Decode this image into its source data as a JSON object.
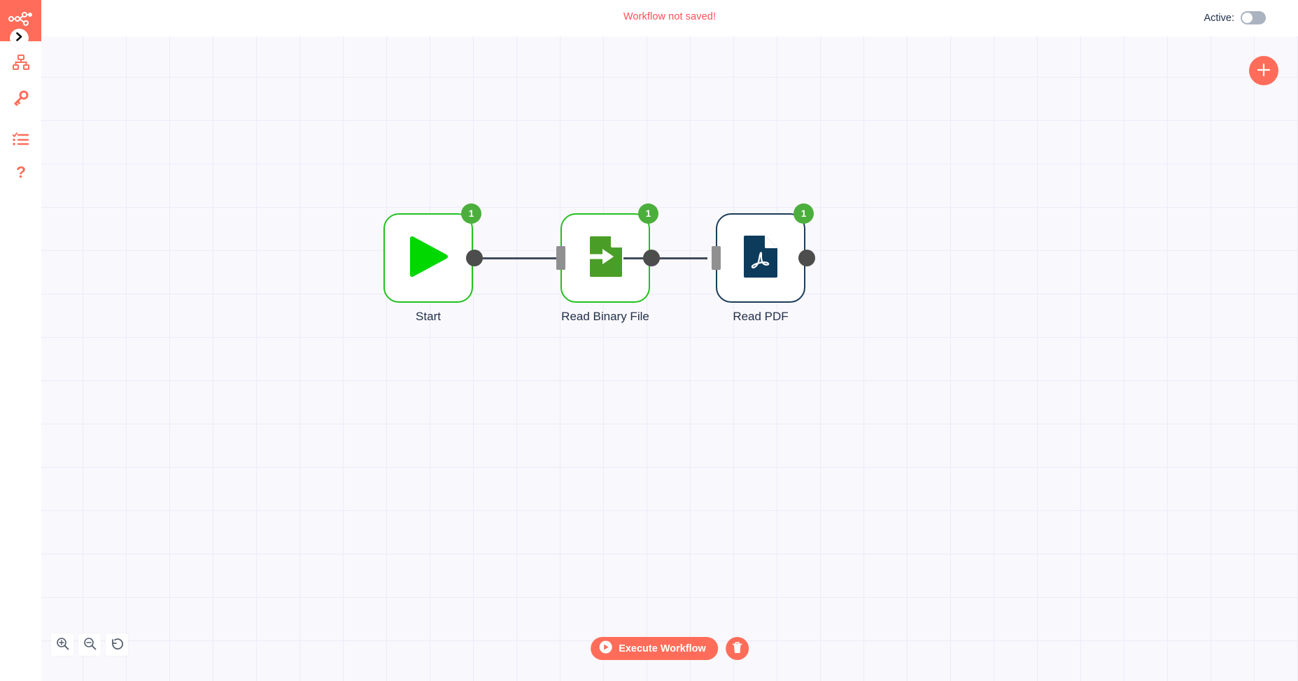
{
  "sidebar": {
    "logo_icon": "n8n-logo-icon",
    "expand_icon": "chevron-right-icon",
    "items": [
      {
        "name": "workflows",
        "icon": "sitemap-icon",
        "label": "Workflows"
      },
      {
        "name": "credentials",
        "icon": "key-icon",
        "label": "Credentials"
      },
      {
        "name": "executions",
        "icon": "checklist-icon",
        "label": "Executions"
      },
      {
        "name": "help",
        "icon": "question-mark-icon",
        "label": "Help"
      }
    ]
  },
  "header": {
    "workflow_status": "Workflow not saved!",
    "active_label": "Active:",
    "active_state": "off"
  },
  "canvas": {
    "add_node_label": "+",
    "add_node_icon": "plus-icon",
    "nodes": [
      {
        "id": "start",
        "label": "Start",
        "icon": "play-triangle-icon",
        "badge": "1",
        "border_color": "#22c11e",
        "accent_color": "#00d800",
        "has_input": false,
        "has_output": true
      },
      {
        "id": "read-binary-file",
        "label": "Read Binary File",
        "icon": "file-import-icon",
        "badge": "1",
        "border_color": "#22c11e",
        "accent_color": "#4a9e28",
        "has_input": true,
        "has_output": true
      },
      {
        "id": "read-pdf",
        "label": "Read PDF",
        "icon": "pdf-file-icon",
        "badge": "1",
        "border_color": "#1a3c5a",
        "accent_color": "#0d3b5c",
        "has_input": true,
        "has_output": true
      }
    ]
  },
  "zoom_controls": [
    {
      "name": "zoom-in",
      "icon": "magnifier-plus-icon",
      "label": "Zoom in"
    },
    {
      "name": "zoom-out",
      "icon": "magnifier-minus-icon",
      "label": "Zoom out"
    },
    {
      "name": "reset-zoom",
      "icon": "undo-arrow-icon",
      "label": "Reset zoom"
    }
  ],
  "run_controls": {
    "execute_label": "Execute Workflow",
    "execute_icon": "play-circle-icon",
    "delete_icon": "trash-icon"
  },
  "colors": {
    "brand": "#ff6d5a",
    "status_warning": "#ff4f5a",
    "badge_green": "#4caf3d",
    "canvas_bg": "#f9f8fd",
    "grid_line": "#edebf8"
  }
}
